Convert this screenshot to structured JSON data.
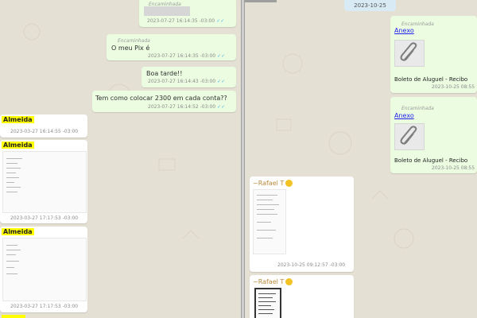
{
  "colors": {
    "outgoing": "#ebfce0",
    "incoming": "#ffffff",
    "highlight": "#ffff00",
    "link": "#2222ee",
    "read_tick": "#4fb6ec",
    "date_chip": "#d8eaf4"
  },
  "left_chat": {
    "top_forward": {
      "forward_label": "Encaminhada",
      "time": "2023-07-27 16:14:35 -03:00"
    },
    "msg_pix": {
      "forward_label": "Encaminhada",
      "text": "O meu Pix é",
      "time": "2023-07-27 16:14:35 -03:00"
    },
    "msg_boa": {
      "text": "Boa tarde!!",
      "time": "2023-07-27 16:14:43 -03:00"
    },
    "msg_tem": {
      "text": "Tem como colocar 2300 em cada conta??",
      "time": "2023-07-27 16:14:52 -03:00"
    },
    "almeida_1": {
      "sender": "Almeida",
      "time": "2023-03-27 16:14:55 -03:00"
    },
    "almeida_2": {
      "sender": "Almeida",
      "time": "2023-03-27 17:17:53 -03:00"
    },
    "almeida_3": {
      "sender": "Almeida",
      "time": "2023-03-27 17:17:53 -03:00"
    },
    "read_tick": "✓✓"
  },
  "right_chat": {
    "date_chip": "2023-10-25",
    "doc_1": {
      "forward_label": "Encaminhada",
      "link": "Anexo",
      "filename": "Boleto de Aluguel - Recibo",
      "time": "2023-10-25 08:55"
    },
    "doc_2": {
      "forward_label": "Encaminhada",
      "link": "Anexo",
      "filename": "Boleto de Aluguel - Recibo",
      "time": "2023-10-25 08:55"
    },
    "rafael_1": {
      "sender": "~Rafael T",
      "time": "2023-10-25 09:12:57 -03:00"
    },
    "rafael_2": {
      "sender": "~Rafael T"
    }
  }
}
